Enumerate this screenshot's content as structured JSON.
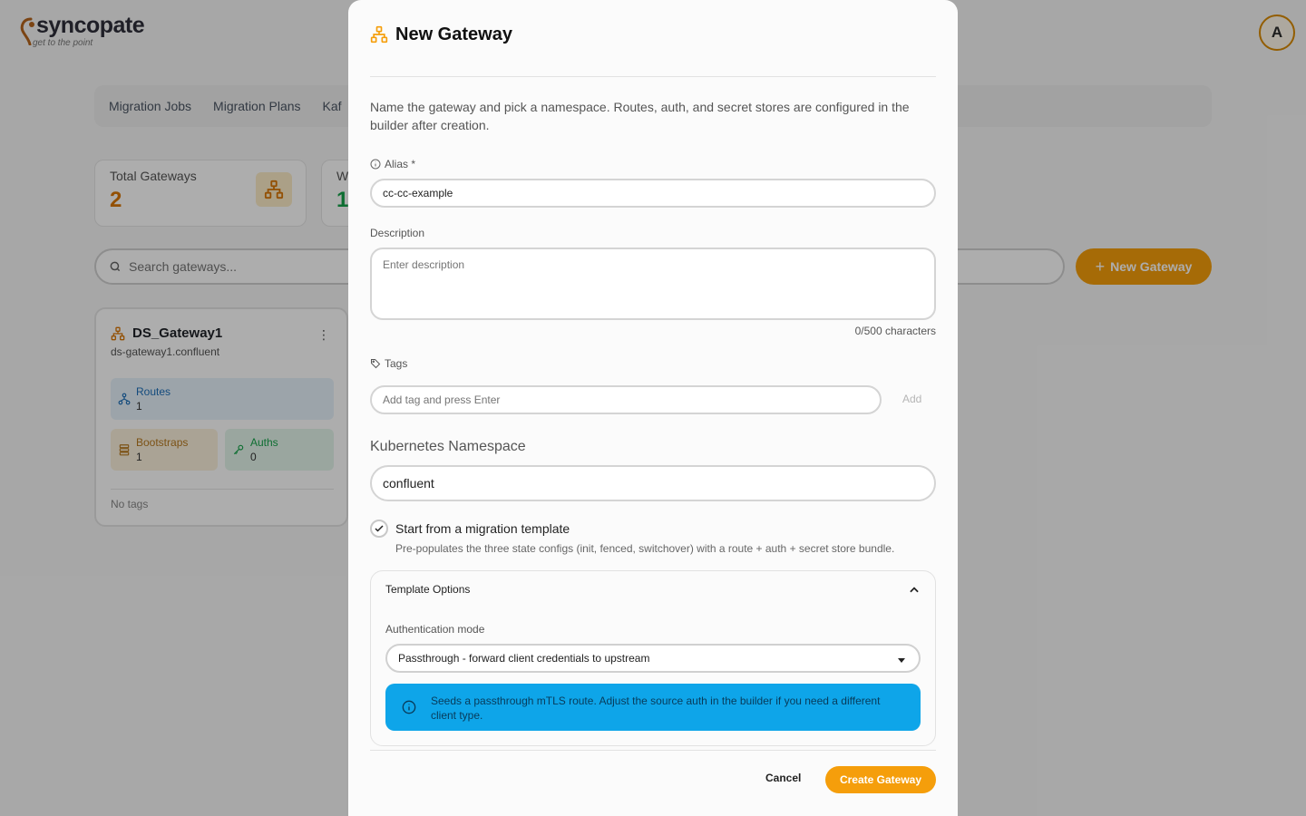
{
  "brand": {
    "name": "syncopate",
    "tagline": "get to the point",
    "accent_color": "#f59e0b"
  },
  "user": {
    "avatar_initial": "A"
  },
  "nav": {
    "items": [
      {
        "label": "Migration Jobs"
      },
      {
        "label": "Migration Plans"
      },
      {
        "label": "Kaf"
      }
    ]
  },
  "stats": {
    "total_gateways": {
      "label": "Total Gateways",
      "value": "2",
      "icon": "gateway-icon"
    },
    "second": {
      "label": "W",
      "value": "1"
    }
  },
  "search": {
    "placeholder": "Search gateways..."
  },
  "new_gateway_button": {
    "label": "New Gateway",
    "icon": "plus-icon"
  },
  "gateway_card": {
    "name": "DS_Gateway1",
    "host": "ds-gateway1.confluent",
    "routes": {
      "label": "Routes",
      "value": "1"
    },
    "bootstraps": {
      "label": "Bootstraps",
      "value": "1"
    },
    "auths": {
      "label": "Auths",
      "value": "0"
    },
    "tags_text": "No tags"
  },
  "modal": {
    "title": "New Gateway",
    "intro": "Name the gateway and pick a namespace. Routes, auth, and secret stores are configured in the builder after creation.",
    "alias": {
      "label": "Alias *",
      "value": "cc-cc-example"
    },
    "description": {
      "label": "Description",
      "placeholder": "Enter description",
      "counter": "0/500 characters"
    },
    "tags": {
      "label": "Tags",
      "placeholder": "Add tag and press Enter",
      "add_label": "Add"
    },
    "namespace": {
      "label": "Kubernetes Namespace",
      "value": "confluent"
    },
    "template_checkbox": {
      "checked": true,
      "label": "Start from a migration template",
      "description": "Pre-populates the three state configs (init, fenced, switchover) with a route + auth + secret store bundle."
    },
    "template_options": {
      "title": "Template Options",
      "expanded": true,
      "auth_mode_label": "Authentication mode",
      "auth_mode_value": "Passthrough - forward client credentials to upstream",
      "info": "Seeds a passthrough mTLS route. Adjust the source auth in the builder if you need a different client type."
    },
    "cancel_label": "Cancel",
    "create_label": "Create Gateway"
  }
}
